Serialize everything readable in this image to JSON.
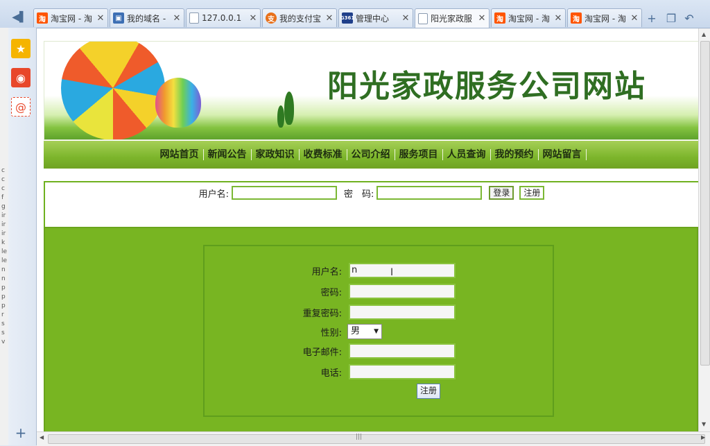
{
  "browser": {
    "tabs": [
      {
        "label": "淘宝网 - 淘",
        "favicon": "taobao-icon",
        "active": false
      },
      {
        "label": "我的域名 - ",
        "favicon": "domain-icon",
        "active": false
      },
      {
        "label": "127.0.0.1",
        "favicon": "page-icon",
        "active": false
      },
      {
        "label": "我的支付宝",
        "favicon": "alipay-icon",
        "active": false
      },
      {
        "label": "管理中心",
        "favicon": "g361-icon",
        "active": false
      },
      {
        "label": "阳光家政服",
        "favicon": "page-icon",
        "active": true
      },
      {
        "label": "淘宝网 - 淘",
        "favicon": "taobao-icon",
        "active": false
      },
      {
        "label": "淘宝网 - 淘",
        "favicon": "taobao-icon",
        "active": false
      }
    ],
    "tab_close_glyph": "✕",
    "new_tab_glyph": "+",
    "taobao_glyph": "淘",
    "alipay_glyph": "支",
    "g_glyph": "G361"
  },
  "site": {
    "banner_title": "阳光家政服务公司网站",
    "nav": [
      "网站首页",
      "新闻公告",
      "家政知识",
      "收费标准",
      "公司介绍",
      "服务项目",
      "人员查询",
      "我的预约",
      "网站留言"
    ],
    "login": {
      "username_label": "用户名:",
      "password_label": "密　码:",
      "login_button": "登录",
      "register_button": "注册"
    },
    "register_form": {
      "username_label": "用户名:",
      "username_value": "n",
      "password_label": "密码:",
      "repeat_password_label": "重复密码:",
      "gender_label": "性别:",
      "gender_value": "男",
      "email_label": "电子邮件:",
      "phone_label": "电话:",
      "submit_label": "注册"
    }
  },
  "left_strip_chars": [
    "c",
    "c",
    "c",
    "f",
    "g",
    "ir",
    "ir",
    "ir",
    "k",
    "le",
    "le",
    "n",
    "n",
    "p",
    "p",
    "p",
    "r",
    "s",
    "s",
    "v"
  ]
}
